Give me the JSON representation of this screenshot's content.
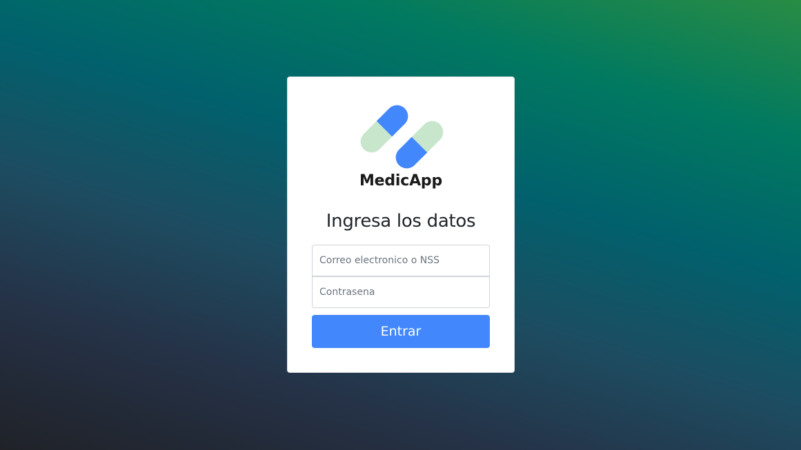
{
  "brand": {
    "name": "MedicApp",
    "logo_icon": "pills-icon",
    "pill_colors": {
      "cap": "#4287fb",
      "body": "#c8e6cc"
    }
  },
  "form": {
    "heading": "Ingresa los datos",
    "email_placeholder": "Correo electronico o NSS",
    "password_placeholder": "Contrasena",
    "submit_label": "Entrar"
  },
  "colors": {
    "accent": "#4287fb",
    "card_bg": "#ffffff"
  }
}
